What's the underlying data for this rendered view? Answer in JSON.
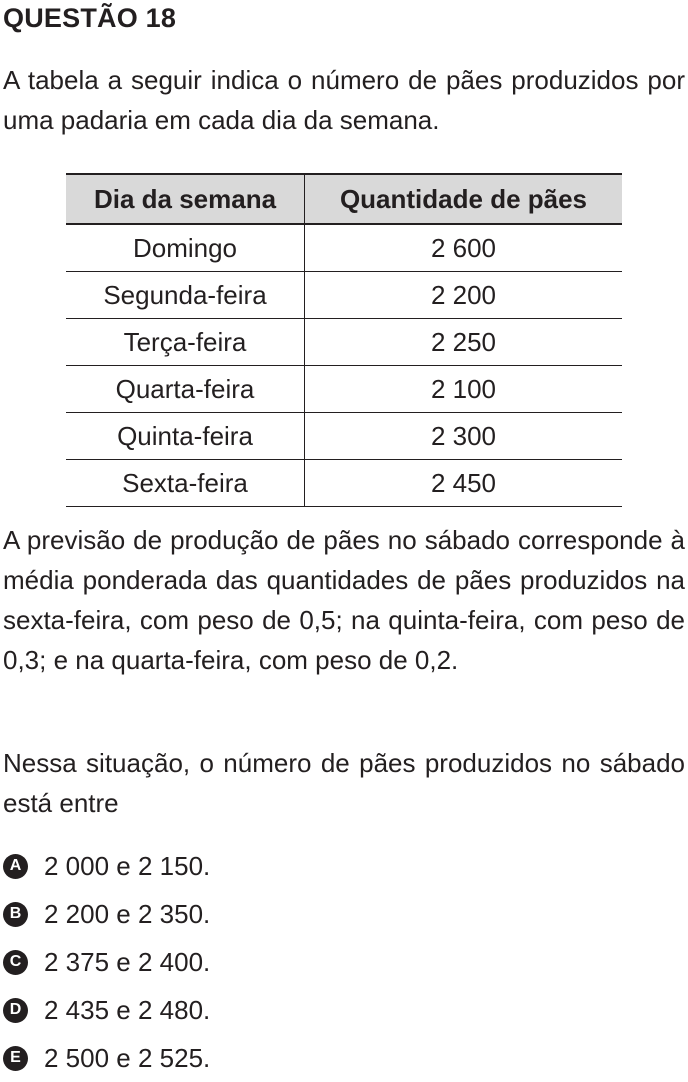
{
  "question": {
    "title": "QUESTÃO 18",
    "intro": "A tabela a seguir indica o número de pães produzidos por uma padaria em cada dia da semana.",
    "body": "A previsão de produção de pães no sábado corresponde à média ponderada das quantidades de pães produzidos na sexta-feira, com peso de 0,5; na quinta-feira, com peso de 0,3; e na quarta-feira, com peso de 0,2.",
    "prompt": "Nessa situação, o número de pães produzidos no sábado está entre"
  },
  "table": {
    "headers": [
      "Dia da semana",
      "Quantidade de pães"
    ],
    "rows": [
      [
        "Domingo",
        "2 600"
      ],
      [
        "Segunda-feira",
        "2 200"
      ],
      [
        "Terça-feira",
        "2 250"
      ],
      [
        "Quarta-feira",
        "2 100"
      ],
      [
        "Quinta-feira",
        "2 300"
      ],
      [
        "Sexta-feira",
        "2 450"
      ]
    ]
  },
  "options": [
    {
      "letter": "A",
      "text": "2 000 e 2 150."
    },
    {
      "letter": "B",
      "text": "2 200 e 2 350."
    },
    {
      "letter": "C",
      "text": "2 375 e 2 400."
    },
    {
      "letter": "D",
      "text": "2 435 e 2 480."
    },
    {
      "letter": "E",
      "text": "2 500 e 2 525."
    }
  ]
}
